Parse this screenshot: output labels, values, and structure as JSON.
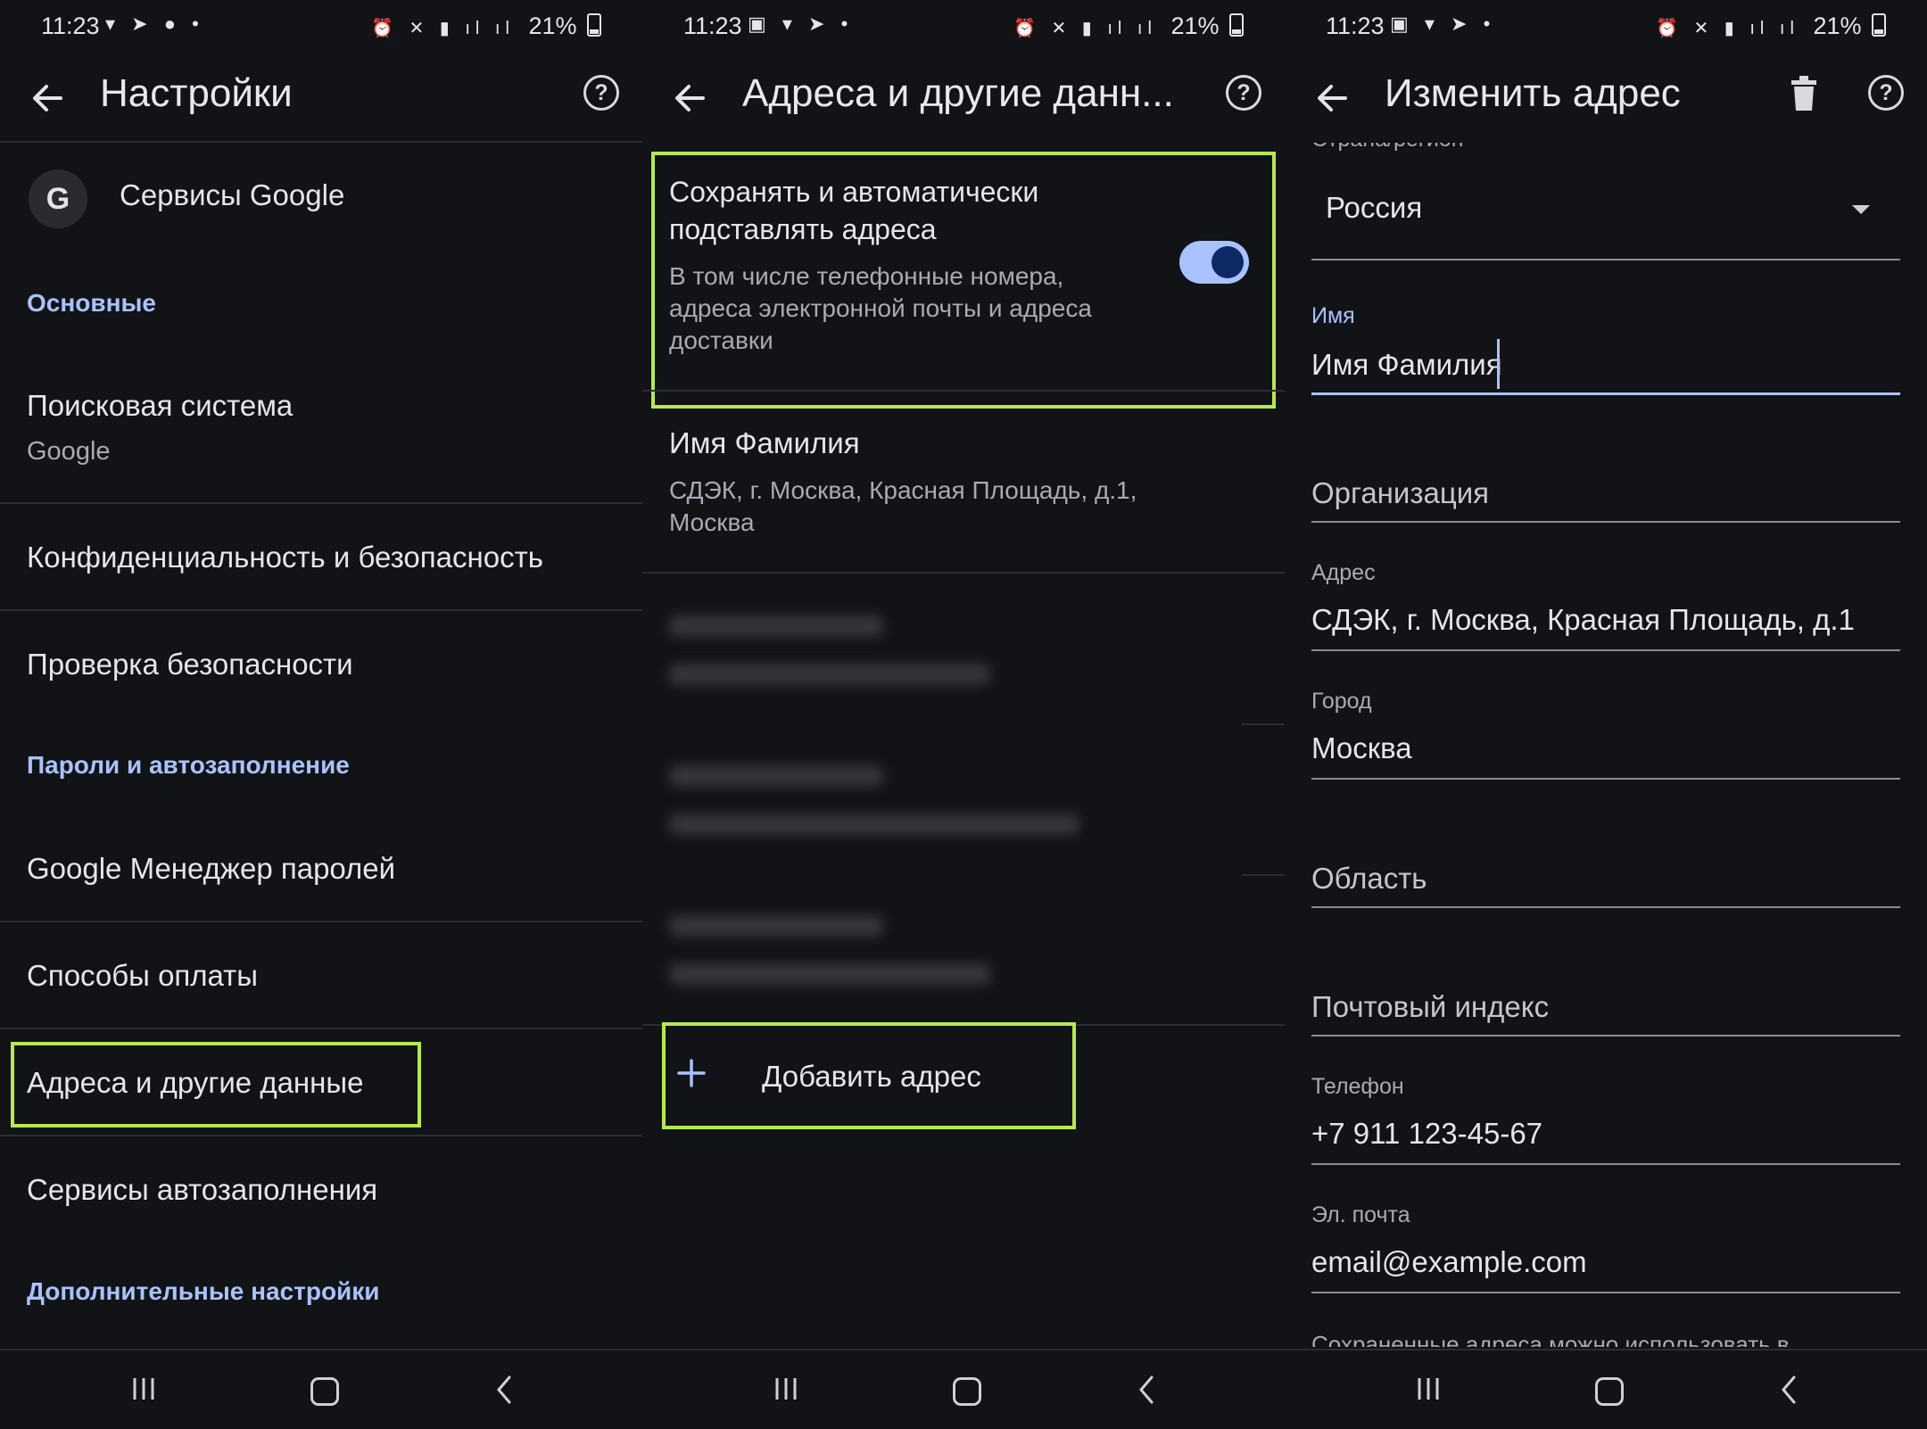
{
  "status": {
    "time": "11:23",
    "battery": "21%"
  },
  "screen1": {
    "title": "Настройки",
    "google_services": "Сервисы Google",
    "google_letter": "G",
    "section_basic": "Основные",
    "search_engine": {
      "label": "Поисковая система",
      "value": "Google"
    },
    "privacy": "Конфиденциальность и безопасность",
    "safety_check": "Проверка безопасности",
    "section_passwords": "Пароли и автозаполнение",
    "password_manager": "Google Менеджер паролей",
    "payment_methods": "Способы оплаты",
    "addresses": "Адреса и другие данные",
    "autofill_services": "Сервисы автозаполнения",
    "section_advanced": "Дополнительные настройки"
  },
  "screen2": {
    "title": "Адреса и другие данн...",
    "toggle_title": "Сохранять и автоматически подставлять адреса",
    "toggle_desc": "В том числе телефонные номера, адреса электронной почты и адреса доставки",
    "toggle_on": true,
    "address_name": "Имя Фамилия",
    "address_detail": "СДЭК, г. Москва, Красная Площадь, д.1, Москва",
    "add_address": "Добавить адрес"
  },
  "screen3": {
    "title": "Изменить адрес",
    "country_label": "Страна/регион",
    "country_value": "Россия",
    "name_label": "Имя",
    "name_value": "Имя Фамилия",
    "organization": "Организация",
    "address_label": "Адрес",
    "address_value": "СДЭК, г. Москва, Красная Площадь, д.1",
    "city_label": "Город",
    "city_value": "Москва",
    "region": "Область",
    "postal_code": "Почтовый индекс",
    "phone_label": "Телефон",
    "phone_value": "+7 911 123-45-67",
    "email_label": "Эл. почта",
    "email_value": "email@example.com",
    "footer_partial": "Сохраненные адреса можно использовать в"
  },
  "colors": {
    "background": "#121317",
    "accent": "#a8c3ff",
    "highlight": "#b5e853",
    "text": "#e6e6ea",
    "secondary_text": "#a9aab2"
  }
}
